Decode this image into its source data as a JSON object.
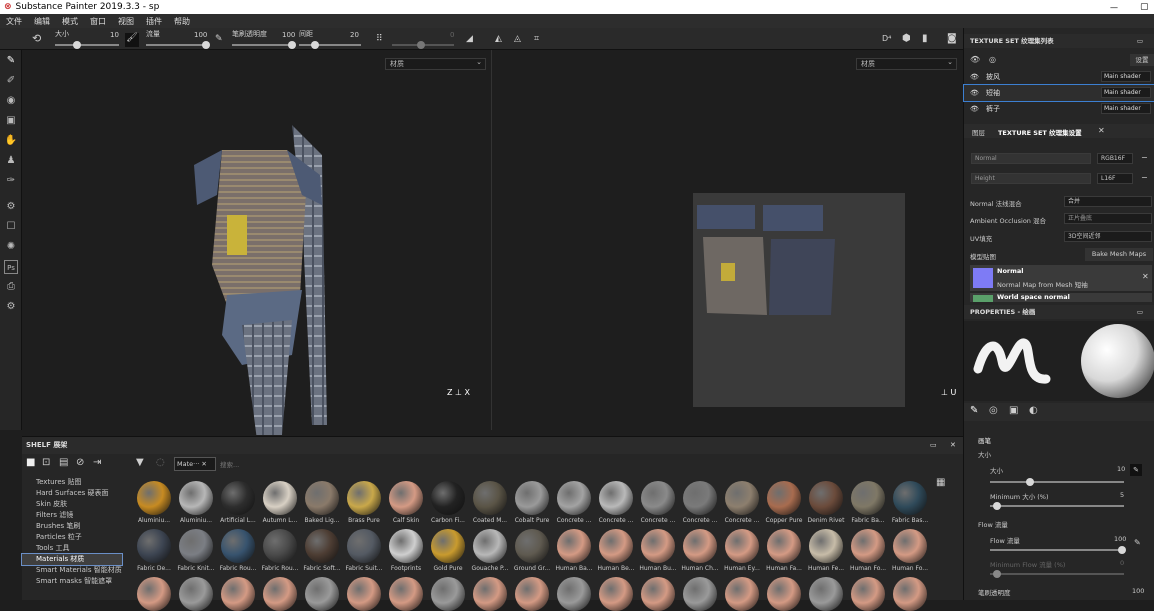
{
  "title_bar": {
    "title": "Substance Painter 2019.3.3 - sp",
    "minimize": "—",
    "maximize": "▢"
  },
  "menu": [
    "文件",
    "编辑",
    "模式",
    "窗口",
    "视图",
    "插件",
    "帮助"
  ],
  "toolbar": {
    "size_label": "大小",
    "size_value": "10",
    "flow_label": "流量",
    "flow_value": "100",
    "opacity_label": "笔刷透明度",
    "opacity_value": "100",
    "spacing_label": "间距",
    "spacing_value": "20",
    "angle_value": "0"
  },
  "viewport3d": {
    "material_select": "材质"
  },
  "viewport2d": {
    "material_select": "材质"
  },
  "shelf": {
    "title": "SHELF 展架",
    "filter_chip": "Mate···",
    "search_placeholder": "搜索...",
    "categories": [
      {
        "label": "Textures 贴图"
      },
      {
        "label": "Hard Surfaces 硬表面"
      },
      {
        "label": "Skin 皮肤"
      },
      {
        "label": "Filters 滤镜"
      },
      {
        "label": "Brushes 笔刷"
      },
      {
        "label": "Particles 粒子"
      },
      {
        "label": "Tools 工具"
      },
      {
        "label": "Materials 材质"
      },
      {
        "label": "Smart Materials 智能材质"
      },
      {
        "label": "Smart masks 智能遮罩"
      }
    ],
    "row1": [
      "Aluminiu...",
      "Aluminiu...",
      "Artificial L...",
      "Autumn L...",
      "Baked Lig...",
      "Brass Pure",
      "Calf Skin",
      "Carbon Fi...",
      "Coated M...",
      "Cobalt Pure",
      "Concrete ...",
      "Concrete ...",
      "Concrete ...",
      "Concrete ...",
      "Concrete ...",
      "Copper Pure",
      "Denim Rivet",
      "Fabric Ba...",
      "Fabric Bas..."
    ],
    "row2": [
      "Fabric De...",
      "Fabric Knit...",
      "Fabric Rou...",
      "Fabric Rou...",
      "Fabric Soft...",
      "Fabric Suit...",
      "Footprints",
      "Gold Pure",
      "Gouache P...",
      "Ground Gr...",
      "Human Ba...",
      "Human Be...",
      "Human Bu...",
      "Human Ch...",
      "Human Ey...",
      "Human Fa...",
      "Human Fe...",
      "Human Fo...",
      "Human Fo..."
    ]
  },
  "texture_set_list": {
    "title": "TEXTURE SET 纹理集列表",
    "settings_btn": "设置",
    "rows": [
      {
        "name": "披风",
        "shader": "Main shader"
      },
      {
        "name": "短袖",
        "shader": "Main shader"
      },
      {
        "name": "裤子",
        "shader": "Main shader"
      }
    ]
  },
  "texture_set_settings": {
    "tab_layers": "图层",
    "tab_settings": "TEXTURE SET 纹理集设置",
    "rows": [
      {
        "name": "Normal",
        "format": "RGB16F"
      },
      {
        "name": "Height",
        "format": "L16F"
      }
    ],
    "normal_mix_label": "Normal 法线混合",
    "normal_mix_value": "合并",
    "ao_mix_label": "Ambient Occlusion 混合",
    "ao_mix_value": "正片叠底",
    "uv_pad_label": "UV填充",
    "uv_pad_value": "3D空间近邻",
    "mesh_maps_label": "模型贴图",
    "bake_btn": "Bake Mesh Maps",
    "map_title": "Normal",
    "map_sub": "Normal Map from Mesh 短袖",
    "map2_title": "World space normal"
  },
  "properties": {
    "title": "PROPERTIES - 绘画",
    "brush_label": "画笔",
    "size_label": "大小",
    "size_sub": "大小",
    "size_value": "10",
    "min_size_label": "Minimum 大小 (%)",
    "min_size_value": "5",
    "flow_section": "Flow 流量",
    "flow_label": "Flow 流量",
    "flow_value": "100",
    "min_flow_label": "Minimum Flow 流量 (%)",
    "min_flow_value": "0",
    "opacity_label": "笔刷透明度",
    "opacity_value": "100"
  }
}
